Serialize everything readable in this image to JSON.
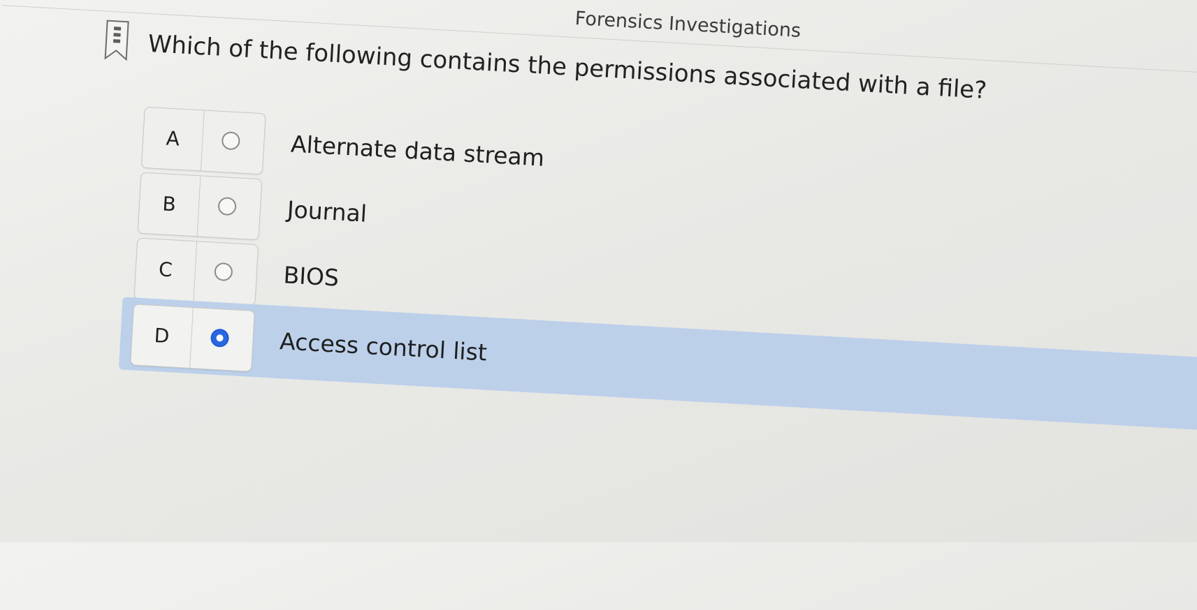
{
  "header": {
    "title": "Forensics Investigations"
  },
  "question": {
    "text": "Which of the following contains the permissions associated with a file?",
    "bookmark_icon": "bookmark-icon"
  },
  "options": [
    {
      "letter": "A",
      "text": "Alternate data stream",
      "selected": false
    },
    {
      "letter": "B",
      "text": "Journal",
      "selected": false
    },
    {
      "letter": "C",
      "text": "BIOS",
      "selected": false
    },
    {
      "letter": "D",
      "text": "Access control list",
      "selected": true
    }
  ],
  "colors": {
    "selected_highlight": "#bcd0ea",
    "radio_selected": "#2a67e0"
  }
}
